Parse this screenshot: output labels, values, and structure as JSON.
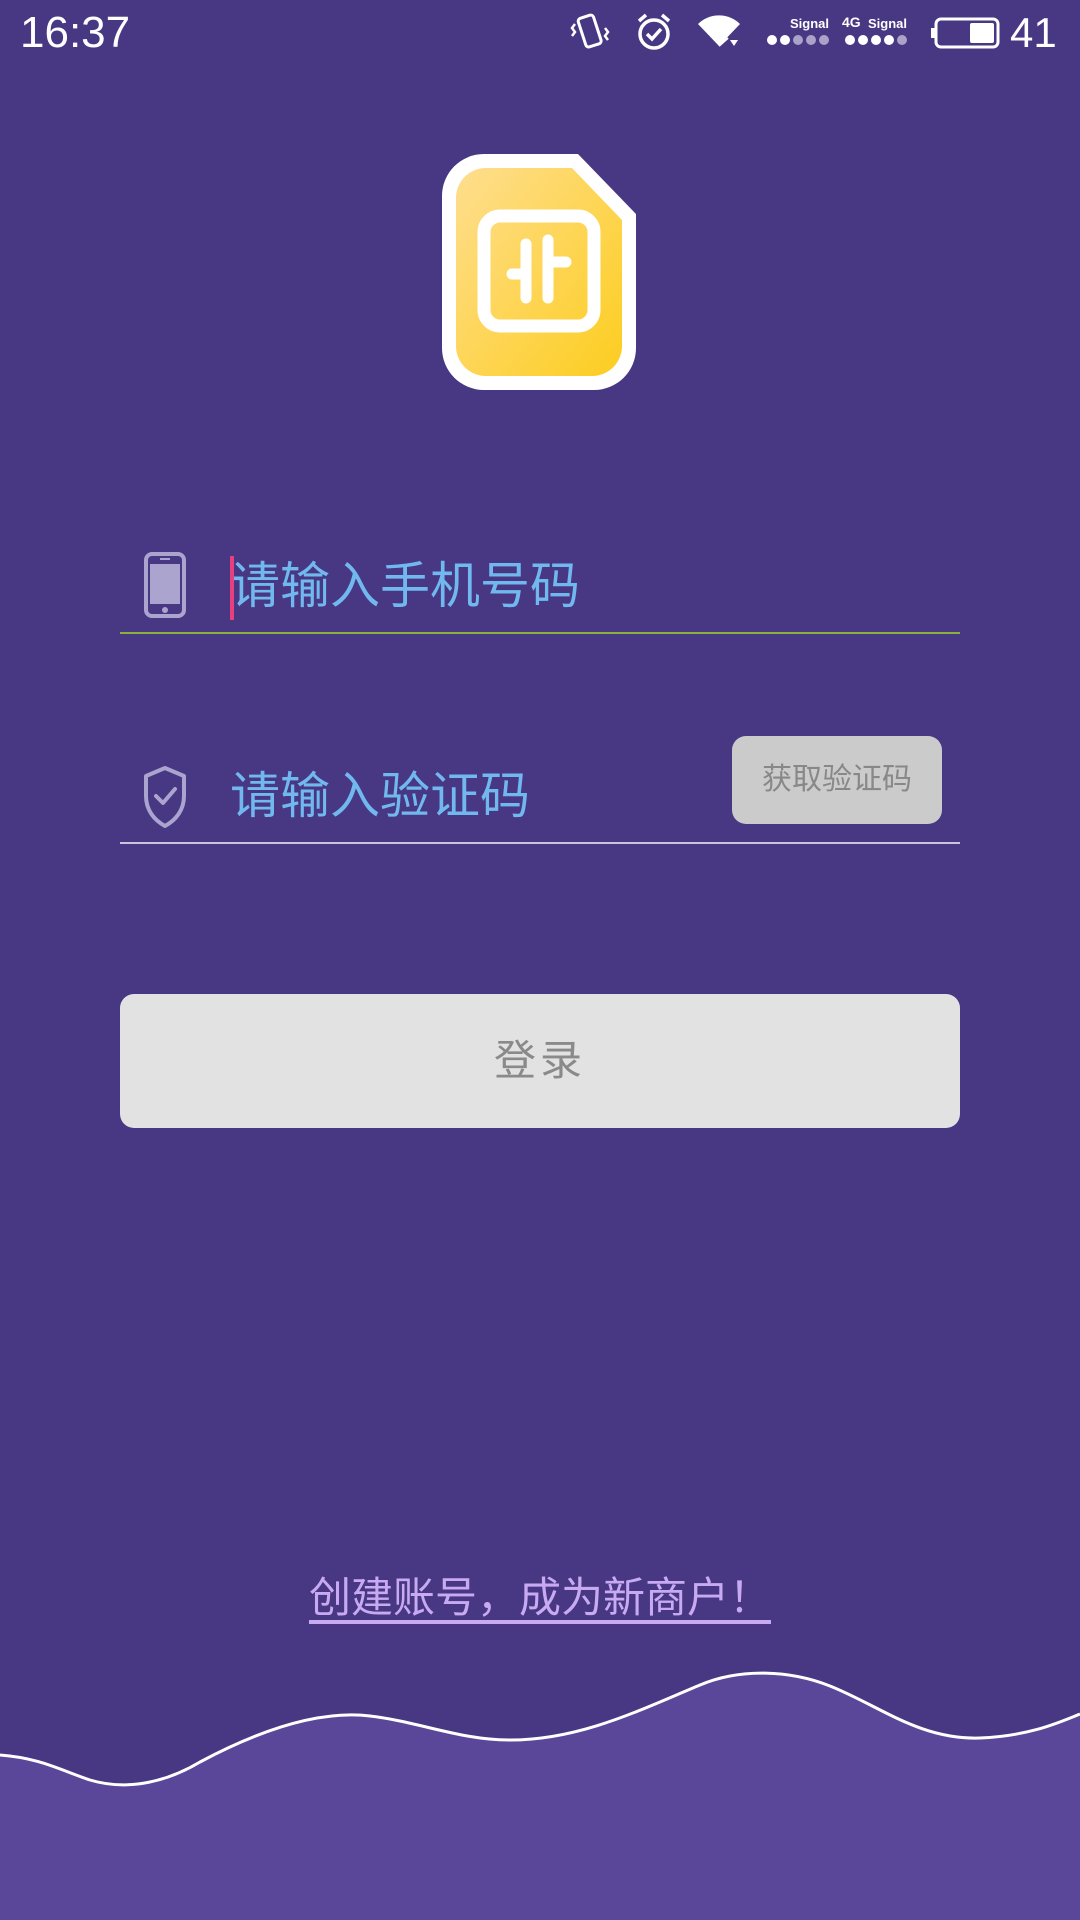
{
  "status_bar": {
    "time": "16:37",
    "battery_level": "41",
    "signal_1_label": "Signal",
    "network_type": "4G",
    "signal_2_label": "Signal"
  },
  "login_form": {
    "phone_placeholder": "请输入手机号码",
    "phone_value": "",
    "code_placeholder": "请输入验证码",
    "code_value": "",
    "get_code_label": "获取验证码",
    "login_label": "登录"
  },
  "register_link": "创建账号，成为新商户！",
  "colors": {
    "background": "#483783",
    "wave_fill": "#5b4799",
    "placeholder": "#71b8ee",
    "caret": "#e6417f",
    "logo_yellow": "#fed24a",
    "link": "#c8aaf3"
  },
  "icons": [
    "vibrate-icon",
    "alarm-icon",
    "wifi-icon",
    "signal-icon",
    "battery-icon",
    "app-logo-icon",
    "phone-icon",
    "shield-check-icon"
  ]
}
